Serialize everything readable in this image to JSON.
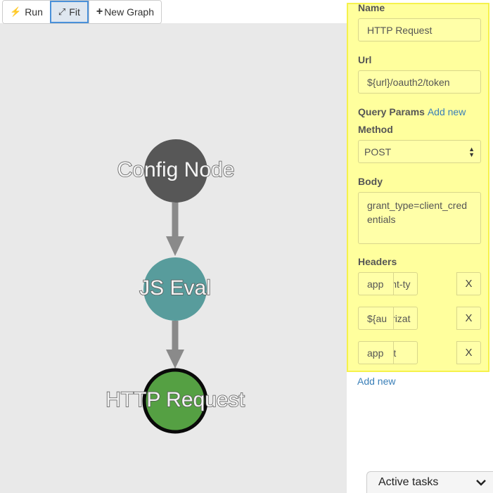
{
  "toolbar": {
    "run_label": "Run",
    "fit_label": "Fit",
    "new_graph_label": "New Graph"
  },
  "graph": {
    "nodes": [
      {
        "label": "Config Node",
        "color": "#575757"
      },
      {
        "label": "JS Eval",
        "color": "#589c9c"
      },
      {
        "label": "HTTP Request",
        "color": "#55a043",
        "selected": true
      }
    ],
    "edges": [
      {
        "from": "Config Node",
        "to": "JS Eval"
      },
      {
        "from": "JS Eval",
        "to": "HTTP Request"
      }
    ]
  },
  "panel": {
    "name_label": "Name",
    "name_value": "HTTP Request",
    "url_label": "Url",
    "url_value": "${url}/oauth2/token",
    "query_params_label": "Query Params",
    "query_params_add": "Add new",
    "method_label": "Method",
    "method_value": "POST",
    "body_label": "Body",
    "body_value": "grant_type=client_credentials",
    "headers_label": "Headers",
    "headers": [
      {
        "key": "content-ty",
        "value": "app",
        "remove": "X"
      },
      {
        "key": "authorizat",
        "value": "${au",
        "remove": "X"
      },
      {
        "key": "accept",
        "value": "app",
        "remove": "X"
      }
    ],
    "headers_add": "Add new",
    "accent_color": "#ffff9d"
  },
  "tasks": {
    "label": "Active tasks"
  }
}
